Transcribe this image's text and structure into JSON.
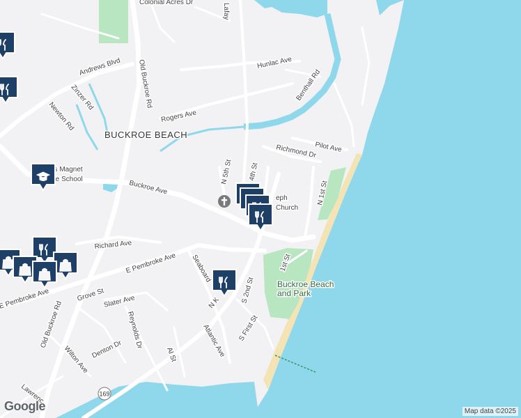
{
  "map": {
    "colors": {
      "water": "#8fd8ec",
      "land": "#f2f2f4",
      "road": "#ffffff",
      "road_edge": "#d6d6dc",
      "park": "#b8e6c0",
      "beach": "#f3e3b5",
      "pin": "#1e3f66"
    },
    "area_label": "BUCKROE BEACH",
    "streets": {
      "colonial_acres": "Colonial Acres Dr",
      "lafayette": "Lafay",
      "hunlac": "Hunlac Ave",
      "benthall": "Benthall Rd",
      "andrews": "Andrews Blvd",
      "old_buckroe_n": "Old Buckroe Rd",
      "zinzer": "Zinzer Rd",
      "newton": "Newton Rd",
      "rogers": "Rogers Ave",
      "pilot": "Pilot Ave",
      "richmond": "Richmond Dr",
      "n5th": "N 5th St",
      "n4th": "4th St",
      "buckroe_ave": "Buckroe Ave",
      "n1st": "N 1st St",
      "richard": "Richard Ave",
      "e_pembroke_1": "E Pembroke Ave",
      "e_pembroke_2": "E Pembroke Ave",
      "seaboard": "Seaboard",
      "first_st": "1st St",
      "grove": "Grove St",
      "slater": "Slater Ave",
      "n_k": "N K",
      "s2nd": "S 2nd St",
      "old_buckroe_s": "Old Buckroe Rd",
      "reynolds": "Reynolds Dr",
      "atlantic": "Atlantic Ave",
      "s_first": "S First St",
      "wilton": "Wilton Ave",
      "denton": "Denton Dr",
      "al": "Al St",
      "lawrence": "Lawrenc",
      "route": "169"
    },
    "places": {
      "school_line1": "es Magnet",
      "school_line2": "dle School",
      "church_line1": "eph",
      "church_line2": "Church",
      "park_line1": "Buckroe Beach",
      "park_line2": "and Park"
    },
    "pins": [
      {
        "kind": "restaurant",
        "icon": "fork-knife-icon"
      },
      {
        "kind": "school",
        "icon": "graduation-cap-icon"
      },
      {
        "kind": "restaurant",
        "icon": "fork-knife-icon"
      },
      {
        "kind": "restaurant",
        "icon": "fork-knife-icon"
      },
      {
        "kind": "restaurant",
        "icon": "fork-knife-icon"
      },
      {
        "kind": "restaurant",
        "icon": "fork-knife-icon"
      },
      {
        "kind": "restaurant",
        "icon": "fork-knife-icon"
      },
      {
        "kind": "shopping",
        "icon": "shopping-bag-icon"
      },
      {
        "kind": "shopping",
        "icon": "shopping-bag-icon"
      },
      {
        "kind": "shopping",
        "icon": "shopping-bag-icon"
      },
      {
        "kind": "shopping",
        "icon": "shopping-bag-icon"
      },
      {
        "kind": "restaurant",
        "icon": "fork-knife-icon"
      },
      {
        "kind": "restaurant",
        "icon": "fork-knife-icon"
      }
    ],
    "church_icon": "church-cross-icon"
  },
  "footer": {
    "logo": "Google",
    "attribution": "Map data ©2025"
  }
}
